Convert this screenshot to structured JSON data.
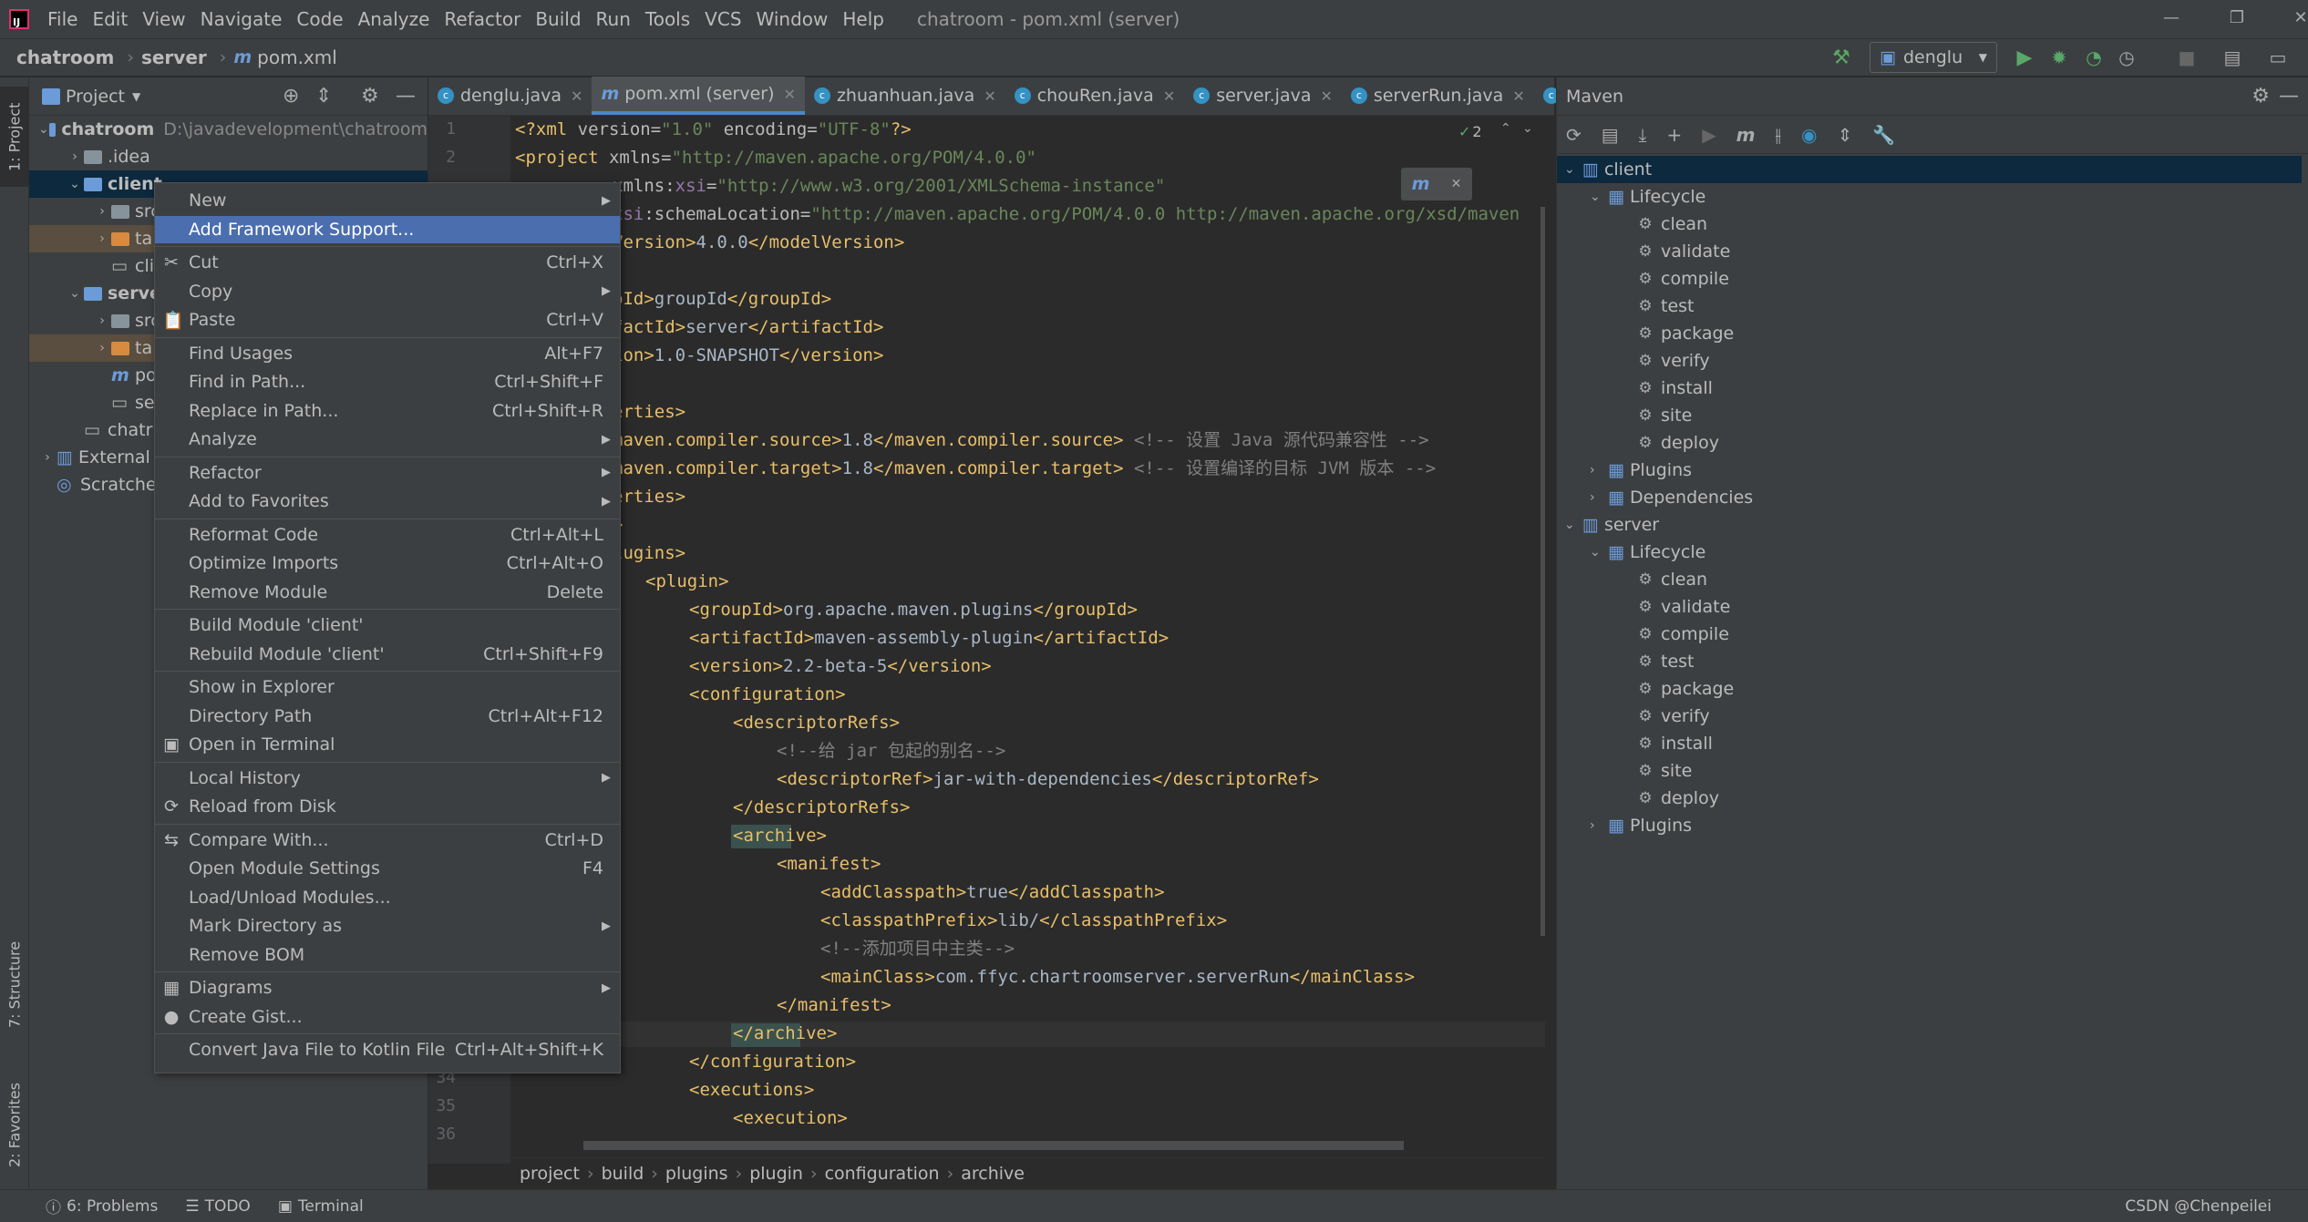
{
  "menubar": {
    "items": [
      "File",
      "Edit",
      "View",
      "Navigate",
      "Code",
      "Analyze",
      "Refactor",
      "Build",
      "Run",
      "Tools",
      "VCS",
      "Window",
      "Help"
    ],
    "window_title": "chatroom - pom.xml (server)"
  },
  "navbar": {
    "crumbs": [
      "chatroom",
      "server",
      "pom.xml"
    ],
    "run_config": "denglu"
  },
  "left_tool_tabs": [
    "1: Project",
    "7: Structure",
    "2: Favorites"
  ],
  "project": {
    "header": "Project",
    "rows": [
      {
        "label": "chatroom",
        "path": "D:\\javadevelopment\\chatroom"
      },
      {
        "label": ".idea"
      },
      {
        "label": "client"
      },
      {
        "label": "src"
      },
      {
        "label": "ta"
      },
      {
        "label": "cli"
      },
      {
        "label": "serve"
      },
      {
        "label": "src"
      },
      {
        "label": "ta"
      },
      {
        "label": "po"
      },
      {
        "label": "se"
      },
      {
        "label": "chatr"
      },
      {
        "label": "External"
      },
      {
        "label": "Scratche"
      }
    ]
  },
  "editor": {
    "tabs": [
      "denglu.java",
      "pom.xml (server)",
      "zhuanhuan.java",
      "chouRen.java",
      "server.java",
      "serverRun.java"
    ],
    "warnings": "2",
    "line_numbers_top": [
      "1",
      "2"
    ],
    "line_numbers_bottom": [
      "34",
      "35",
      "36"
    ],
    "breadcrumb": [
      "project",
      "build",
      "plugins",
      "plugin",
      "configuration",
      "archive"
    ]
  },
  "context_menu": {
    "items": [
      {
        "label": "New",
        "submenu": true
      },
      {
        "label": "Add Framework Support...",
        "highlight": true
      },
      {
        "label": "Cut",
        "shortcut": "Ctrl+X",
        "icon": "cut-icon"
      },
      {
        "label": "Copy",
        "submenu": true
      },
      {
        "label": "Paste",
        "shortcut": "Ctrl+V",
        "icon": "paste-icon"
      },
      {
        "label": "Find Usages",
        "shortcut": "Alt+F7"
      },
      {
        "label": "Find in Path...",
        "shortcut": "Ctrl+Shift+F"
      },
      {
        "label": "Replace in Path...",
        "shortcut": "Ctrl+Shift+R"
      },
      {
        "label": "Analyze",
        "submenu": true
      },
      {
        "label": "Refactor",
        "submenu": true
      },
      {
        "label": "Add to Favorites",
        "submenu": true
      },
      {
        "label": "Reformat Code",
        "shortcut": "Ctrl+Alt+L"
      },
      {
        "label": "Optimize Imports",
        "shortcut": "Ctrl+Alt+O"
      },
      {
        "label": "Remove Module",
        "shortcut": "Delete"
      },
      {
        "label": "Build Module 'client'"
      },
      {
        "label": "Rebuild Module 'client'",
        "shortcut": "Ctrl+Shift+F9"
      },
      {
        "label": "Show in Explorer"
      },
      {
        "label": "Directory Path",
        "shortcut": "Ctrl+Alt+F12"
      },
      {
        "label": "Open in Terminal",
        "icon": "terminal-icon"
      },
      {
        "label": "Local History",
        "submenu": true
      },
      {
        "label": "Reload from Disk",
        "icon": "reload-icon"
      },
      {
        "label": "Compare With...",
        "shortcut": "Ctrl+D",
        "icon": "compare-icon"
      },
      {
        "label": "Open Module Settings",
        "shortcut": "F4"
      },
      {
        "label": "Load/Unload Modules..."
      },
      {
        "label": "Mark Directory as",
        "submenu": true
      },
      {
        "label": "Remove BOM"
      },
      {
        "label": "Diagrams",
        "submenu": true,
        "icon": "diagram-icon"
      },
      {
        "label": "Create Gist...",
        "icon": "github-icon"
      },
      {
        "label": "Convert Java File to Kotlin File",
        "shortcut": "Ctrl+Alt+Shift+K"
      }
    ]
  },
  "maven": {
    "title": "Maven",
    "client": "client",
    "server": "server",
    "lifecycle": "Lifecycle",
    "phases": [
      "clean",
      "validate",
      "compile",
      "test",
      "package",
      "verify",
      "install",
      "site",
      "deploy"
    ],
    "plugins": "Plugins",
    "dependencies": "Dependencies"
  },
  "statusbar": {
    "problems": "6: Problems",
    "todo": "TODO",
    "terminal": "Terminal",
    "watermark": "CSDN @Chenpeilei"
  }
}
